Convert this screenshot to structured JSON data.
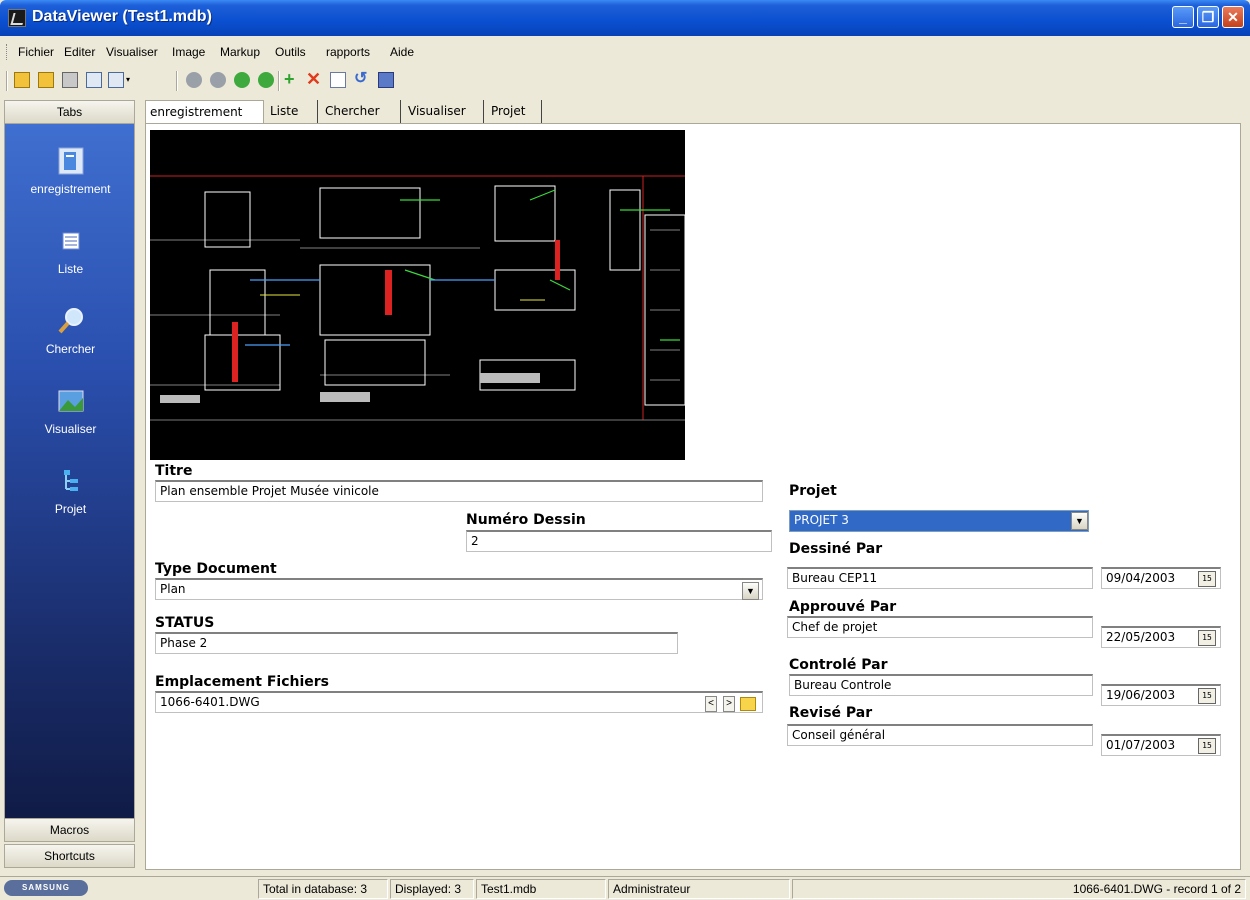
{
  "window": {
    "title": "DataViewer (Test1.mdb)"
  },
  "menu": [
    "Fichier",
    "Editer",
    "Visualiser",
    "Image",
    "Markup",
    "Outils",
    "rapports",
    "Aide"
  ],
  "left_panel": {
    "header": "Tabs",
    "items": [
      {
        "label": "enregistrement",
        "icon": "record-icon"
      },
      {
        "label": "Liste",
        "icon": "list-icon"
      },
      {
        "label": "Chercher",
        "icon": "search-icon"
      },
      {
        "label": "Visualiser",
        "icon": "view-image-icon"
      },
      {
        "label": "Projet",
        "icon": "project-tree-icon"
      }
    ],
    "footer": [
      "Macros",
      "Shortcuts"
    ]
  },
  "tabs": [
    "enregistrement",
    "Liste",
    "Chercher",
    "Visualiser",
    "Projet"
  ],
  "form": {
    "titre_label": "Titre",
    "titre_value": "Plan ensemble Projet Musée vinicole",
    "numero_label": "Numéro Dessin",
    "numero_value": "2",
    "type_label": "Type Document",
    "type_value": "Plan",
    "status_label": "STATUS",
    "status_value": "Phase 2",
    "emplacement_label": "Emplacement Fichiers",
    "emplacement_value": "1066-6401.DWG",
    "projet_label": "Projet",
    "projet_value": "PROJET 3",
    "dessine_label": "Dessiné Par",
    "dessine_value": "Bureau CEP11",
    "dessine_date": "09/04/2003",
    "approuve_label": "Approuvé Par",
    "approuve_value": "Chef de projet",
    "approuve_date": "22/05/2003",
    "controle_label": "Controlé Par",
    "controle_value": "Bureau Controle",
    "controle_date": "19/06/2003",
    "revise_label": "Revisé Par",
    "revise_value": "Conseil général",
    "revise_date": "01/07/2003",
    "prev_btn": "<",
    "next_btn": ">"
  },
  "status_bar": {
    "logo": "SAMSUNG",
    "total": "Total in database: 3",
    "displayed": "Displayed: 3",
    "db": "Test1.mdb",
    "user": "Administrateur",
    "record": "1066-6401.DWG - record 1 of 2"
  },
  "colors": {
    "title_bar": "#0a4fd0",
    "selection": "#3169c6",
    "panel_top": "#3f6fd0",
    "panel_bottom": "#101b46"
  }
}
